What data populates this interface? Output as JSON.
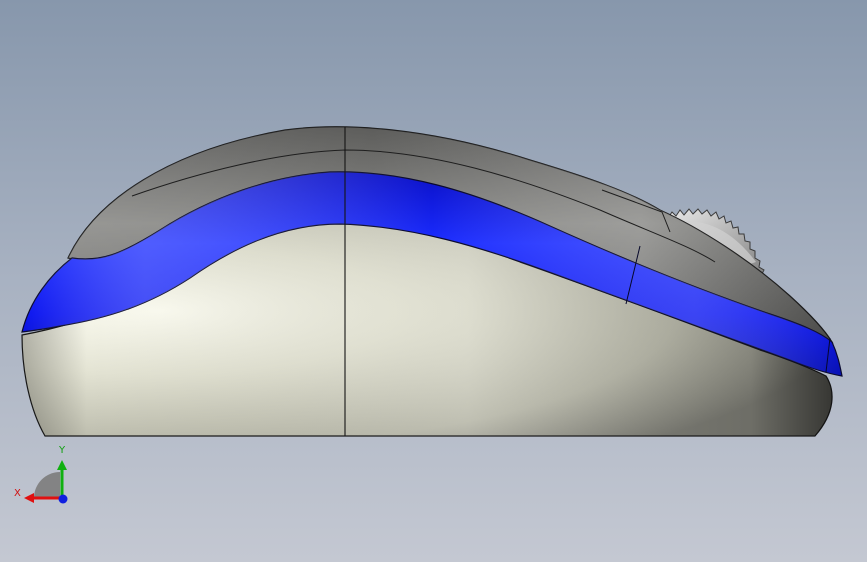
{
  "viewport": {
    "background_top": "#8797ac",
    "background_bottom": "#c4c8d2"
  },
  "model": {
    "body_color": "#e6e6d6",
    "top_shell_color": "#6f6f6c",
    "stripe_color": "#0a13f2",
    "wheel_color": "#c8c8c8",
    "edge_color": "#141414"
  },
  "triad": {
    "x_label": "X",
    "y_label": "Y",
    "x_color": "#e01010",
    "y_color": "#10b010",
    "z_color": "#1020e0"
  }
}
